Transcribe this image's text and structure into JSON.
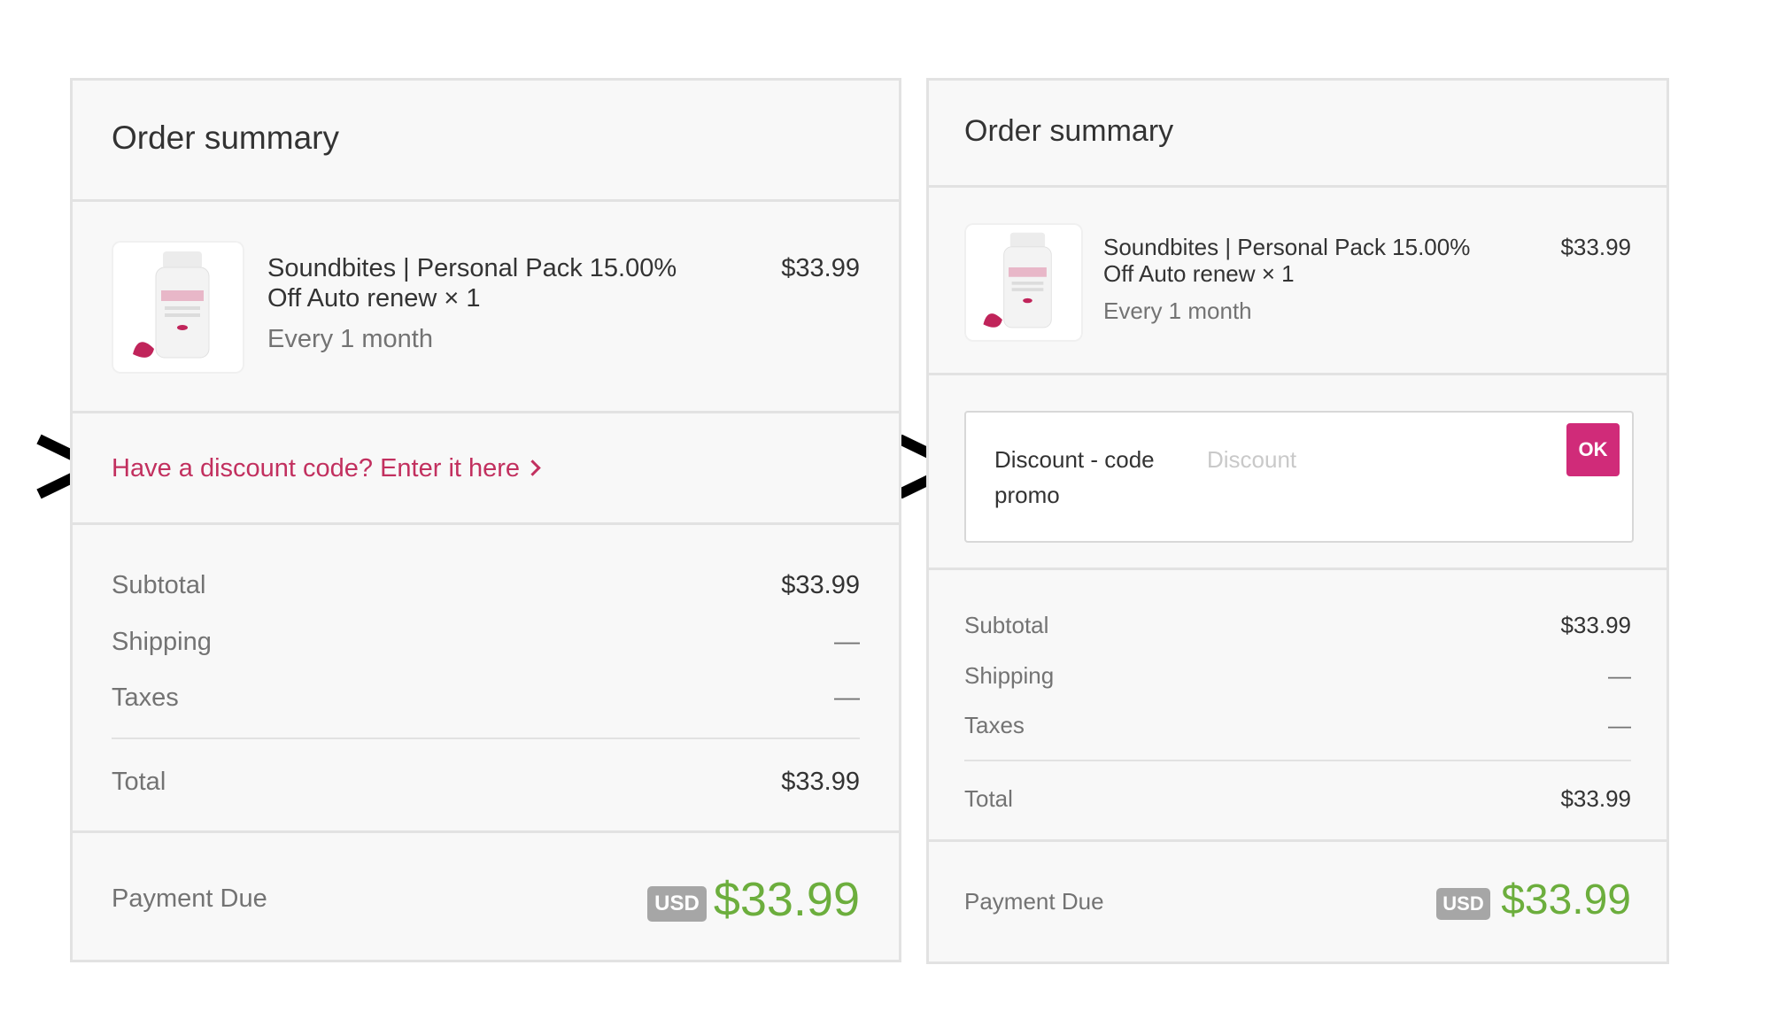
{
  "left_panel": {
    "title": "Order summary",
    "product": {
      "name_line1": "Soundbites | Personal Pack 15.00%",
      "name_line2": "Off Auto renew × 1",
      "frequency": "Every 1 month",
      "price": "$33.99"
    },
    "discount_link": "Have a discount code? Enter it here",
    "summary": {
      "subtotal_label": "Subtotal",
      "subtotal_value": "$33.99",
      "shipping_label": "Shipping",
      "shipping_value": "—",
      "taxes_label": "Taxes",
      "taxes_value": "—",
      "total_label": "Total",
      "total_value": "$33.99"
    },
    "payment": {
      "label": "Payment Due",
      "currency": "USD",
      "amount": "$33.99"
    }
  },
  "right_panel": {
    "title": "Order summary",
    "product": {
      "name_line1": "Soundbites | Personal Pack 15.00%",
      "name_line2": "Off Auto renew × 1",
      "frequency": "Every 1 month",
      "price": "$33.99"
    },
    "discount_form": {
      "label_line1": "Discount - code",
      "label_line2": "promo",
      "placeholder": "Discount",
      "button": "OK"
    },
    "summary": {
      "subtotal_label": "Subtotal",
      "subtotal_value": "$33.99",
      "shipping_label": "Shipping",
      "shipping_value": "—",
      "taxes_label": "Taxes",
      "taxes_value": "—",
      "total_label": "Total",
      "total_value": "$33.99"
    },
    "payment": {
      "label": "Payment Due",
      "currency": "USD",
      "amount": "$33.99"
    }
  },
  "colors": {
    "accent": "#c2305f",
    "button": "#d02b79",
    "amount_green": "#6cae3d",
    "arrow": "#000000"
  },
  "icons": [
    "product-bottle-image",
    "chevron-right-icon",
    "annotation-arrow-icon"
  ]
}
